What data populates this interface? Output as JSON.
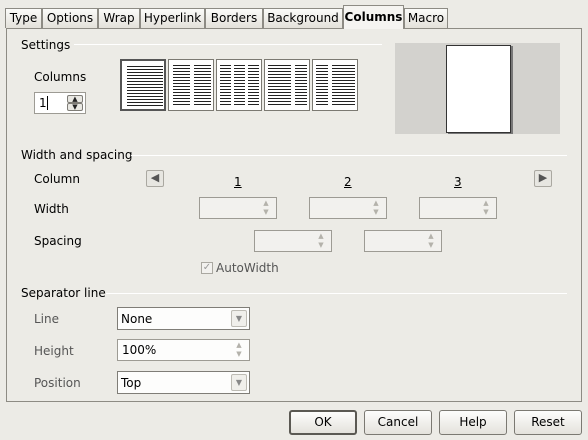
{
  "tabs": [
    {
      "label": "Type"
    },
    {
      "label": "Options"
    },
    {
      "label": "Wrap"
    },
    {
      "label": "Hyperlink"
    },
    {
      "label": "Borders"
    },
    {
      "label": "Background"
    },
    {
      "label": "Columns"
    },
    {
      "label": "Macro"
    }
  ],
  "settings": {
    "section_label": "Settings",
    "columns_label": "Columns",
    "columns_value": "1"
  },
  "width_spacing": {
    "section_label": "Width and spacing",
    "column_label": "Column",
    "width_label": "Width",
    "spacing_label": "Spacing",
    "col_numbers": [
      "1",
      "2",
      "3"
    ],
    "autowidth_label": "AutoWidth"
  },
  "separator": {
    "section_label": "Separator line",
    "line_label": "Line",
    "line_value": "None",
    "height_label": "Height",
    "height_value": "100%",
    "position_label": "Position",
    "position_value": "Top"
  },
  "buttons": {
    "ok": "OK",
    "cancel": "Cancel",
    "help": "Help",
    "reset": "Reset"
  }
}
